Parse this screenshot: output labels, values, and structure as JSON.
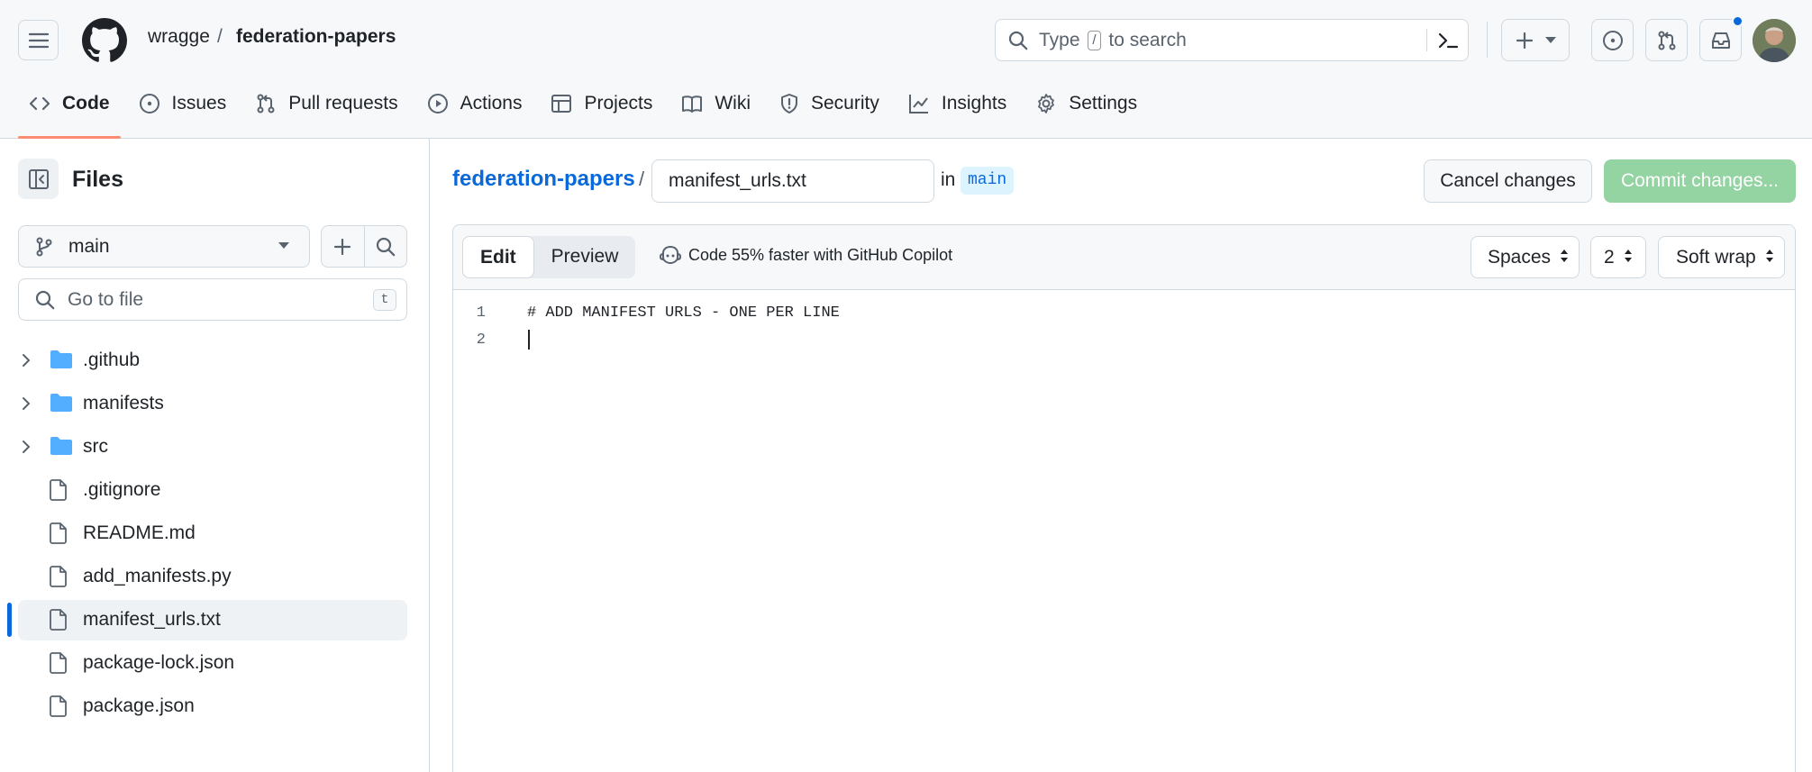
{
  "header": {
    "owner": "wragge",
    "separator": "/",
    "repo": "federation-papers",
    "search": {
      "prefix": "Type",
      "key": "/",
      "suffix": "to search"
    }
  },
  "repo_nav": [
    {
      "label": "Code",
      "icon": "code-icon",
      "active": true
    },
    {
      "label": "Issues",
      "icon": "issue-opened-icon"
    },
    {
      "label": "Pull requests",
      "icon": "git-pull-request-icon"
    },
    {
      "label": "Actions",
      "icon": "play-icon"
    },
    {
      "label": "Projects",
      "icon": "table-icon"
    },
    {
      "label": "Wiki",
      "icon": "book-icon"
    },
    {
      "label": "Security",
      "icon": "shield-icon"
    },
    {
      "label": "Insights",
      "icon": "graph-icon"
    },
    {
      "label": "Settings",
      "icon": "gear-icon"
    }
  ],
  "sidebar": {
    "title": "Files",
    "branch": "main",
    "goto_placeholder": "Go to file",
    "goto_key": "t",
    "tree": [
      {
        "name": ".github",
        "type": "folder"
      },
      {
        "name": "manifests",
        "type": "folder"
      },
      {
        "name": "src",
        "type": "folder"
      },
      {
        "name": ".gitignore",
        "type": "file"
      },
      {
        "name": "README.md",
        "type": "file"
      },
      {
        "name": "add_manifests.py",
        "type": "file"
      },
      {
        "name": "manifest_urls.txt",
        "type": "file",
        "selected": true
      },
      {
        "name": "package-lock.json",
        "type": "file"
      },
      {
        "name": "package.json",
        "type": "file"
      }
    ]
  },
  "editor_header": {
    "repo_link": "federation-papers",
    "separator": "/",
    "filename": "manifest_urls.txt",
    "in_label": "in",
    "branch": "main",
    "cancel_label": "Cancel changes",
    "commit_label": "Commit changes..."
  },
  "editor": {
    "tabs": {
      "edit": "Edit",
      "preview": "Preview"
    },
    "copilot_text": "Code 55% faster with GitHub Copilot",
    "indent_mode": "Spaces",
    "indent_size": "2",
    "wrap_mode": "Soft wrap",
    "lines": [
      {
        "num": "1",
        "text": "# ADD MANIFEST URLS - ONE PER LINE"
      },
      {
        "num": "2",
        "text": ""
      }
    ]
  },
  "colors": {
    "accent": "#0969da",
    "commit_disabled": "#94d3a2",
    "active_tab_underline": "#fd8c73",
    "folder": "#54aeff"
  }
}
